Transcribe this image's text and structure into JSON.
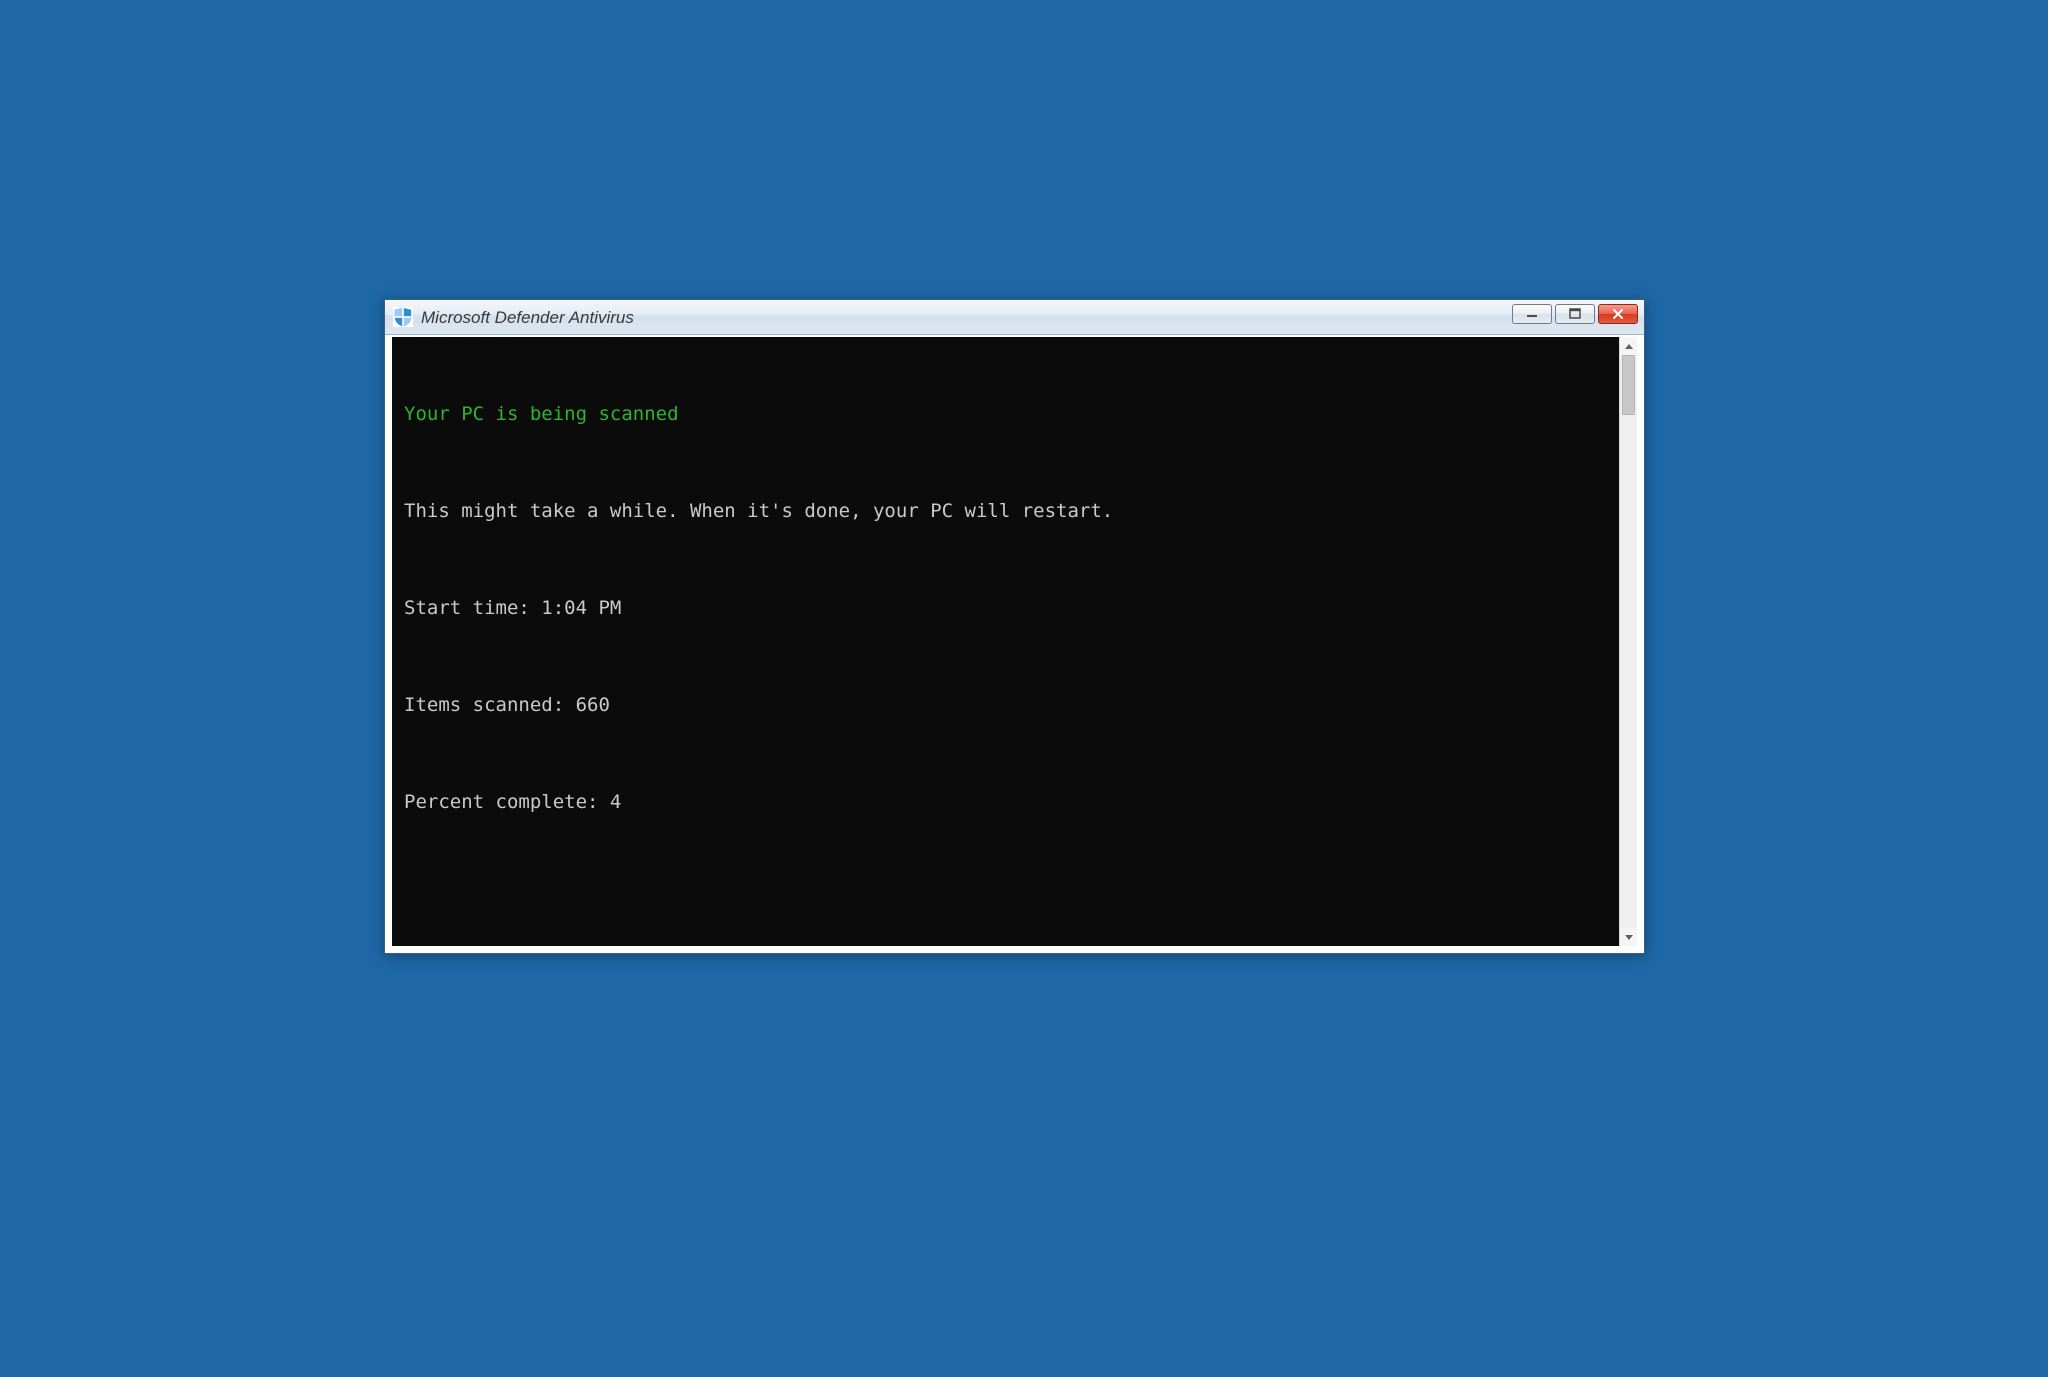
{
  "window": {
    "title": "Microsoft Defender Antivirus"
  },
  "console": {
    "heading": "Your PC is being scanned",
    "message": "This might take a while. When it's done, your PC will restart.",
    "start_time_label": "Start time: ",
    "start_time_value": "1:04 PM",
    "items_scanned_label": "Items scanned: ",
    "items_scanned_value": "660",
    "percent_complete_label": "Percent complete: ",
    "percent_complete_value": "4"
  },
  "icons": {
    "app": "defender-shield-icon",
    "minimize": "minimize-icon",
    "maximize": "maximize-icon",
    "close": "close-icon",
    "scroll_up": "chevron-up-icon",
    "scroll_down": "chevron-down-icon"
  },
  "colors": {
    "desktop": "#1e68a8",
    "console_bg": "#0b0b0b",
    "console_text": "#c9c9c9",
    "console_heading": "#2db52d",
    "close_accent": "#d63a1f"
  }
}
